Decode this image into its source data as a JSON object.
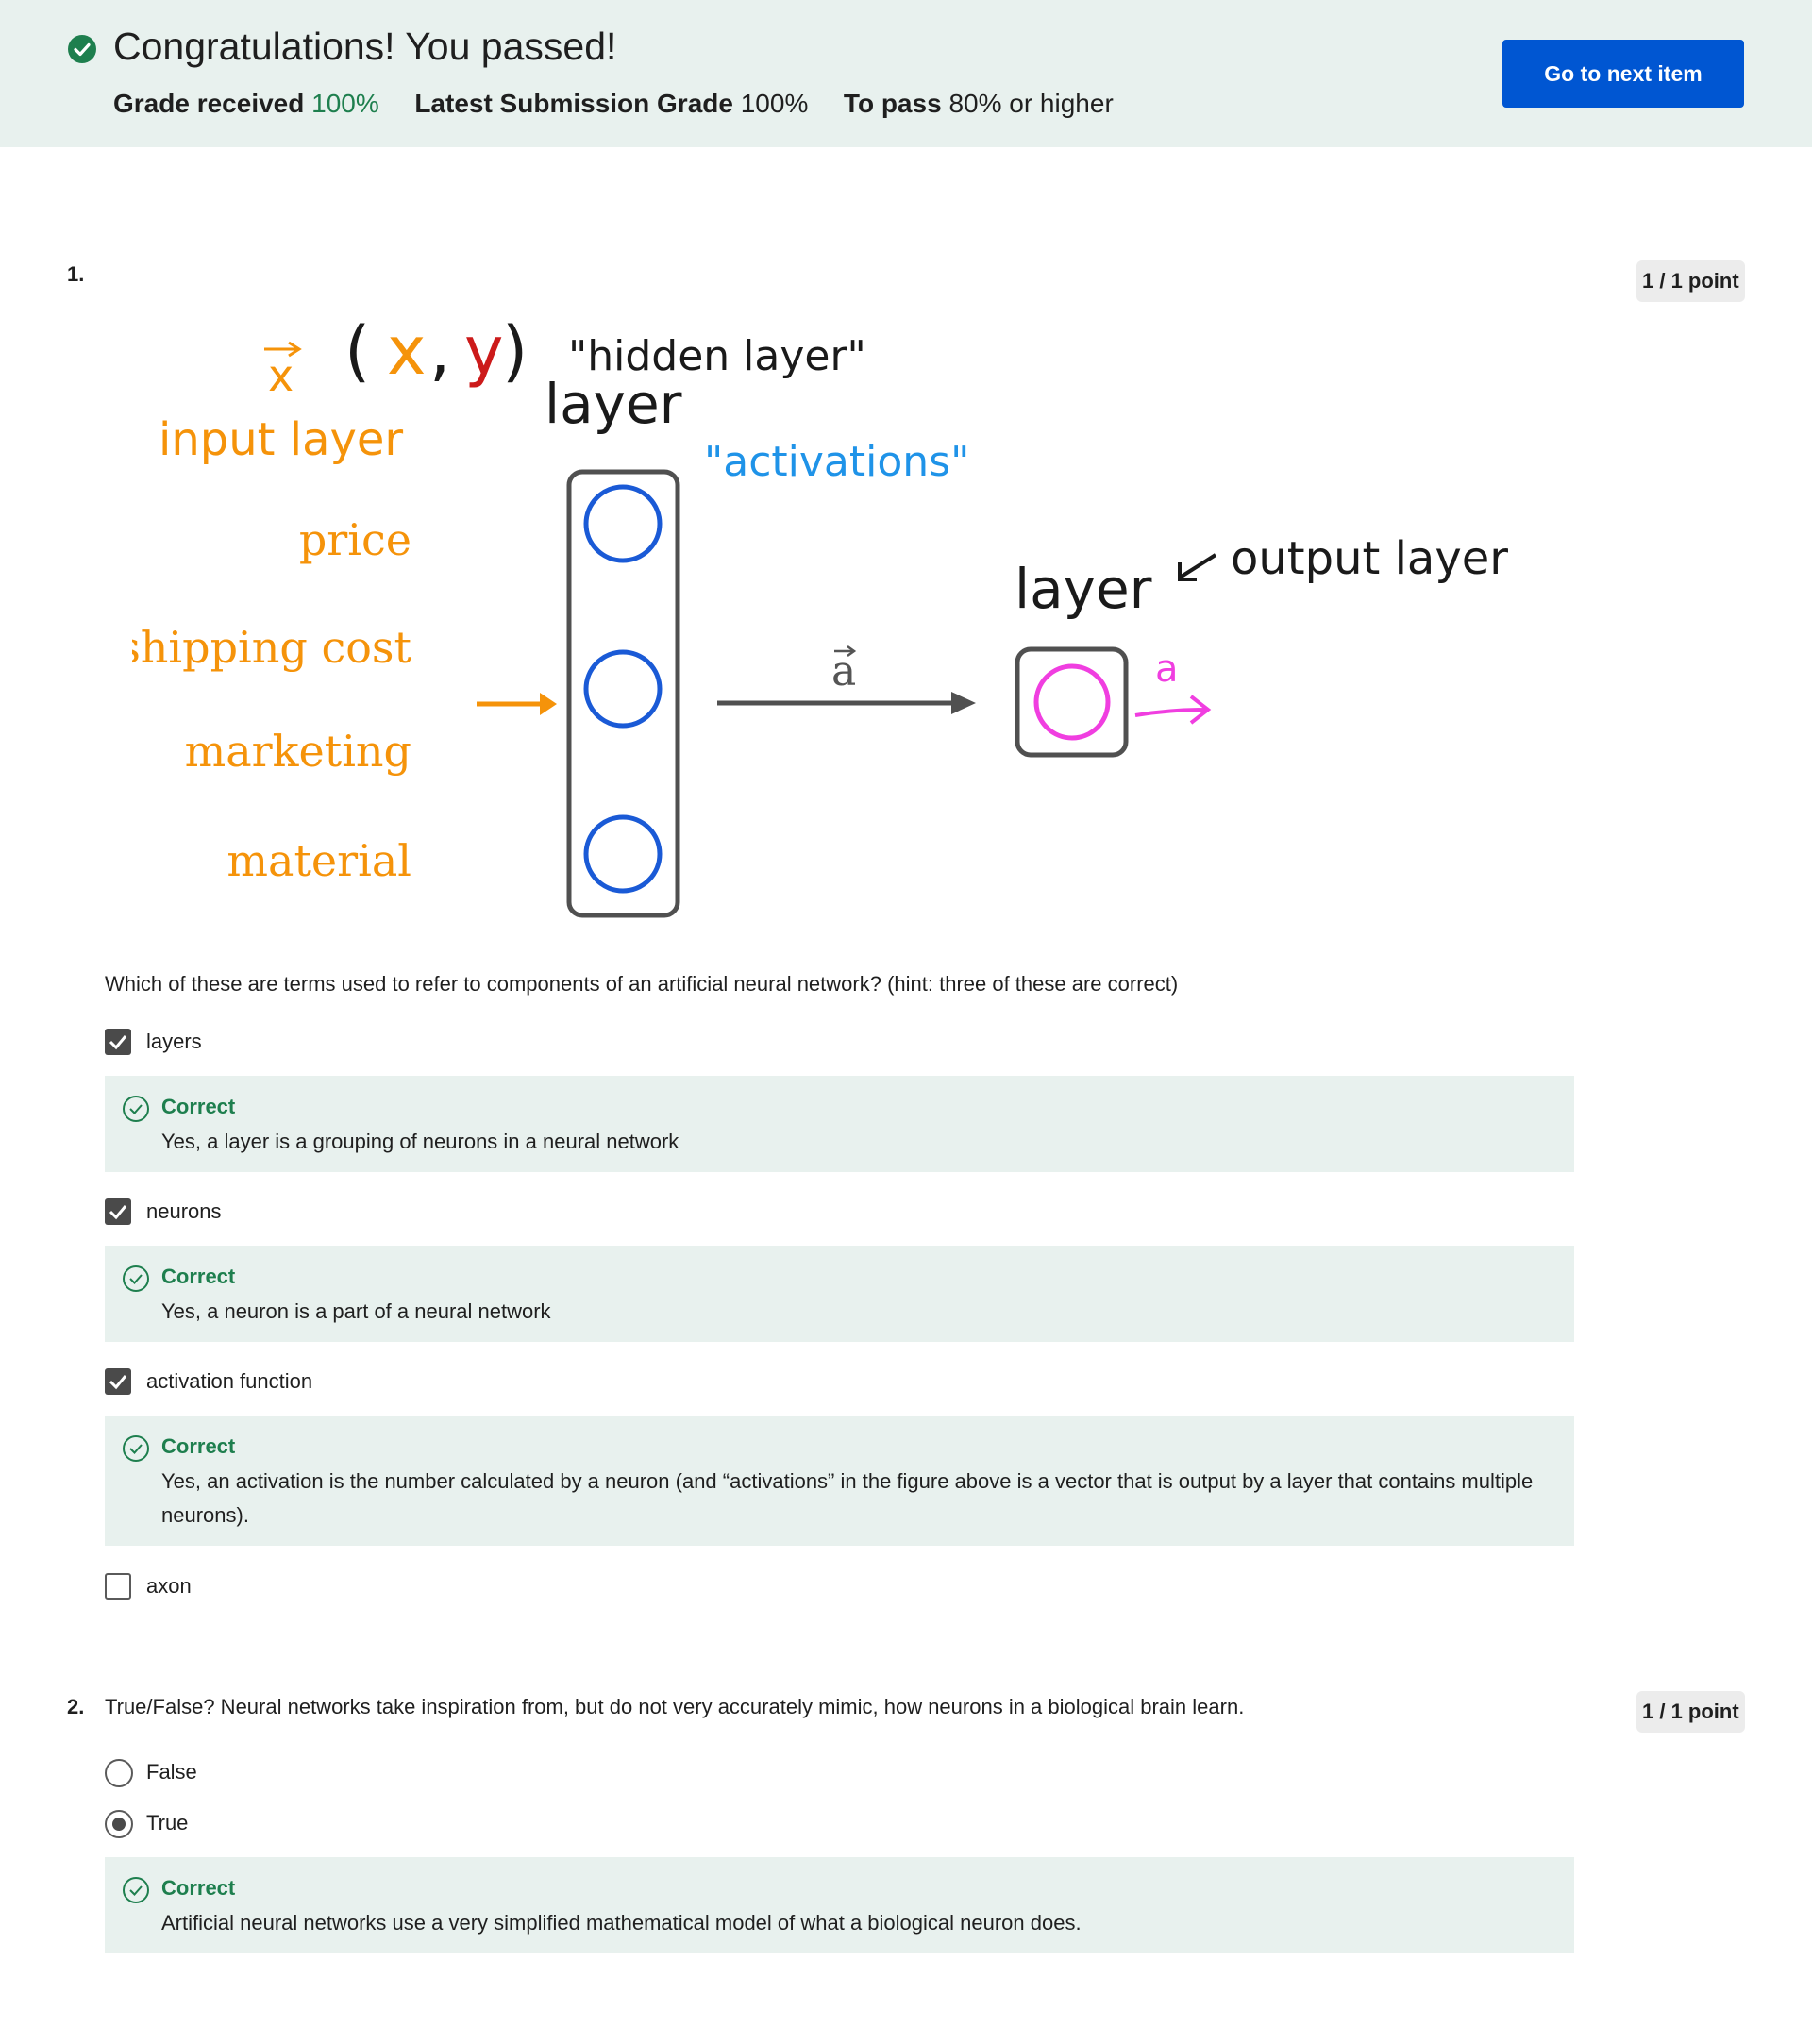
{
  "banner": {
    "title": "Congratulations! You passed!",
    "grade_received_label": "Grade received",
    "grade_received_value": "100%",
    "latest_label": "Latest Submission Grade",
    "latest_value": "100%",
    "to_pass_label": "To pass",
    "to_pass_value": "80% or higher",
    "next_button": "Go to next item",
    "check_icon": "check-circle-icon"
  },
  "figure": {
    "x_vec": "x",
    "xy_open": "(",
    "xy_x": "x",
    "xy_comma": ",",
    "xy_y": "y",
    "xy_close": ")",
    "hidden_layer_note": "\"hidden layer\"",
    "layer_top": "layer",
    "input_layer_note": "input layer",
    "activations_note": "\"activations\"",
    "features": [
      "price",
      "shipping cost",
      "marketing",
      "material"
    ],
    "a_vec_label": "a",
    "layer_right": "layer",
    "output_layer_note": "output layer",
    "output_a": "a",
    "colors": {
      "orange": "#f5930a",
      "blue": "#1a5ad6",
      "light_blue": "#1f93e8",
      "magenta": "#f03ee0",
      "red": "#cc1a1a",
      "gray": "#505050"
    }
  },
  "questions": [
    {
      "number": "1.",
      "points": "1 / 1 point",
      "text": "Which of these are terms used to refer to components of an artificial neural network? (hint: three of these are correct)",
      "options": [
        {
          "label": "layers",
          "checked": true
        },
        {
          "label": "neurons",
          "checked": true
        },
        {
          "label": "activation function",
          "checked": true
        },
        {
          "label": "axon",
          "checked": false
        }
      ],
      "feedback": [
        {
          "title": "Correct",
          "text": "Yes, a layer is a grouping of neurons in a neural network"
        },
        {
          "title": "Correct",
          "text": "Yes, a neuron is a part of a neural network"
        },
        {
          "title": "Correct",
          "text": "Yes, an activation is the number calculated by a neuron (and “activations” in the figure above is a vector that is output by a layer that contains multiple neurons)."
        }
      ]
    },
    {
      "number": "2.",
      "points": "1 / 1 point",
      "text": "True/False? Neural networks take inspiration from, but do not very accurately mimic, how neurons in a biological brain learn.",
      "options": [
        {
          "label": "False",
          "selected": false
        },
        {
          "label": "True",
          "selected": true
        }
      ],
      "feedback": [
        {
          "title": "Correct",
          "text": "Artificial neural networks use a very simplified mathematical model of what a biological neuron does."
        }
      ]
    }
  ]
}
